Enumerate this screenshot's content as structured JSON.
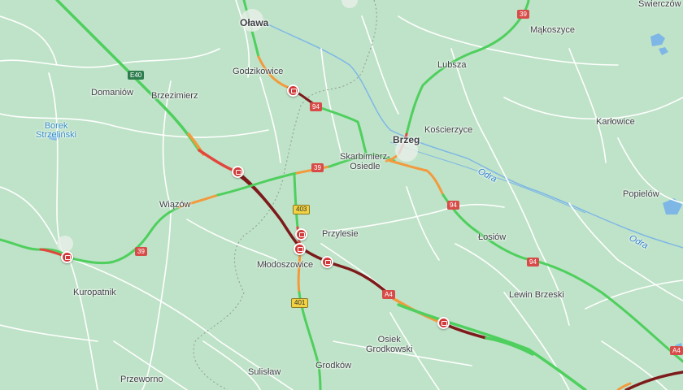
{
  "map": {
    "places": [
      {
        "name": "Oława",
        "type": "city"
      },
      {
        "name": "Godzikowice",
        "type": "town"
      },
      {
        "name": "Domaniów",
        "type": "town"
      },
      {
        "name": "Brzezimierz",
        "type": "town"
      },
      {
        "name": "Borek\nStrzeliński",
        "type": "park"
      },
      {
        "name": "Mąkoszyce",
        "type": "town"
      },
      {
        "name": "Lubsza",
        "type": "town"
      },
      {
        "name": "Świerczów",
        "type": "town"
      },
      {
        "name": "Kościerzyce",
        "type": "town"
      },
      {
        "name": "Karłowice",
        "type": "town"
      },
      {
        "name": "Brzeg",
        "type": "city"
      },
      {
        "name": "Skarbimierz-\nOsiedle",
        "type": "town"
      },
      {
        "name": "Wiązów",
        "type": "town"
      },
      {
        "name": "Odra",
        "type": "water"
      },
      {
        "name": "Popielów",
        "type": "town"
      },
      {
        "name": "Odra",
        "type": "water"
      },
      {
        "name": "Przylesie",
        "type": "town"
      },
      {
        "name": "Łosiów",
        "type": "town"
      },
      {
        "name": "Kuropatnik",
        "type": "town"
      },
      {
        "name": "Młodoszowice",
        "type": "town"
      },
      {
        "name": "Lewin Brzeski",
        "type": "town"
      },
      {
        "name": "Osiek\nGrodkowski",
        "type": "town"
      },
      {
        "name": "Sulisław",
        "type": "town"
      },
      {
        "name": "Grodków",
        "type": "town"
      },
      {
        "name": "Przeworno",
        "type": "town"
      }
    ],
    "shields": [
      {
        "text": "E40",
        "color": "green"
      },
      {
        "text": "39",
        "color": "red"
      },
      {
        "text": "94",
        "color": "red"
      },
      {
        "text": "39",
        "color": "red"
      },
      {
        "text": "403",
        "color": "yellow"
      },
      {
        "text": "94",
        "color": "red"
      },
      {
        "text": "39",
        "color": "red"
      },
      {
        "text": "94",
        "color": "red"
      },
      {
        "text": "A4",
        "color": "red"
      },
      {
        "text": "401",
        "color": "yellow"
      },
      {
        "text": "A4",
        "color": "red"
      }
    ],
    "incidents_count": 7,
    "colors": {
      "land": "#bfe3c8",
      "minor_road": "#ffffff",
      "traffic_free": "#4fcf5e",
      "traffic_slow": "#f29a3d",
      "traffic_heavy": "#e2463d",
      "traffic_jam": "#7d1b1b",
      "water": "#7eb7e6",
      "incident": "#d13a3a"
    }
  }
}
